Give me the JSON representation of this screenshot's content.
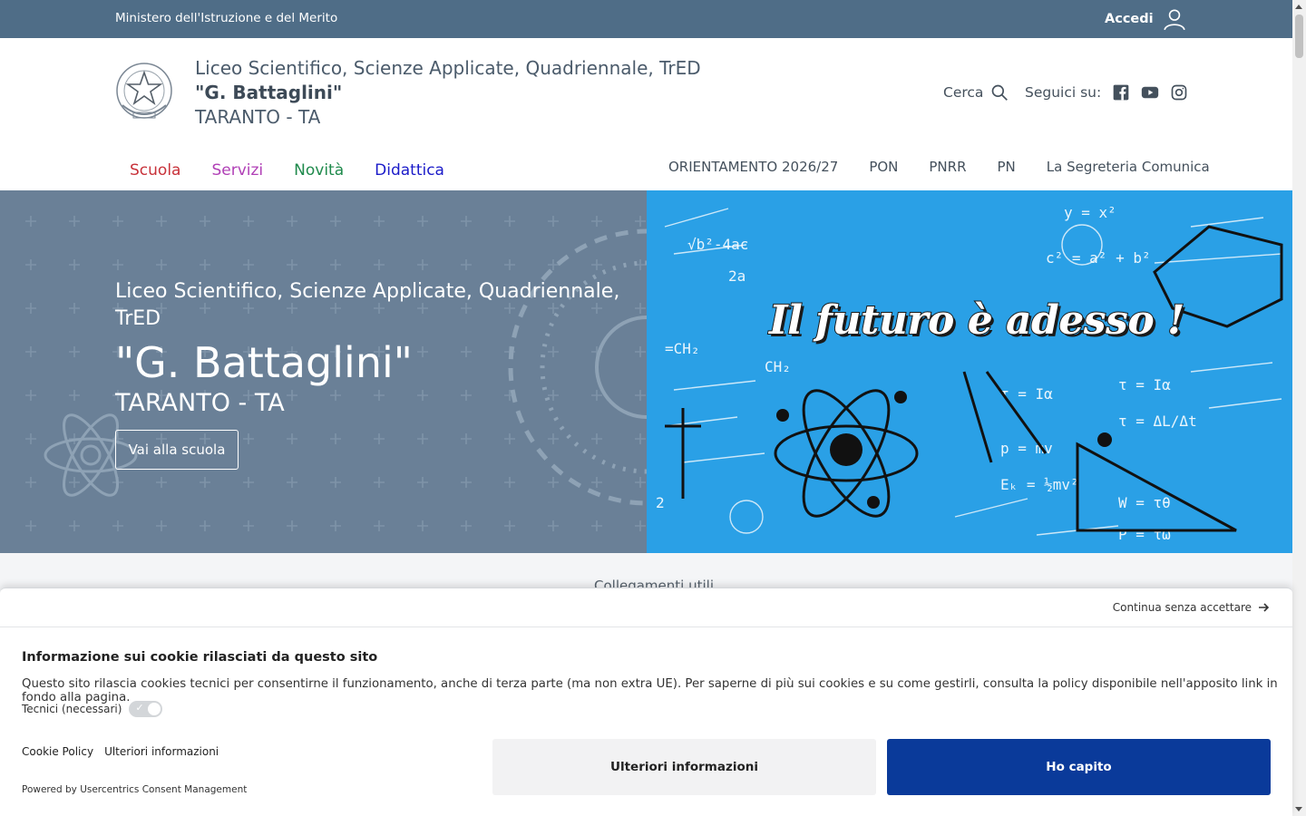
{
  "topbar": {
    "ministry": "Ministero dell'Istruzione e del Merito",
    "login": "Accedi"
  },
  "header": {
    "school_type": "Liceo Scientifico, Scienze Applicate, Quadriennale, TrED",
    "school_name": "\"G. Battaglini\"",
    "school_city": "TARANTO - TA",
    "search_label": "Cerca",
    "follow_label": "Seguici su:",
    "social_icons": [
      "facebook-icon",
      "youtube-icon",
      "instagram-icon"
    ]
  },
  "main_nav": [
    {
      "label": "Scuola",
      "color": "#c8323a"
    },
    {
      "label": "Servizi",
      "color": "#b03fb6"
    },
    {
      "label": "Novità",
      "color": "#1f8a4c"
    },
    {
      "label": "Didattica",
      "color": "#1b1bc9"
    }
  ],
  "secondary_nav": [
    "ORIENTAMENTO 2026/27",
    "PON",
    "PNRR",
    "PN",
    "La Segreteria Comunica"
  ],
  "hero": {
    "line1": "Liceo Scientifico, Scienze Applicate, Quadriennale, TrED",
    "line2": "\"G. Battaglini\"",
    "line3": "TARANTO - TA",
    "button": "Vai alla scuola",
    "image_slogan": "Il futuro è adesso !"
  },
  "useful_links": "Collegamenti utili",
  "cookie": {
    "continue": "Continua senza accettare",
    "title": "Informazione sui cookie rilasciati da questo sito",
    "description": "Questo sito rilascia cookies tecnici per consentirne il funzionamento, anche di terza parte (ma non extra UE). Per saperne di più sui cookies e su come gestirli, consulta la policy disponibile nell'apposito link in fondo alla pagina.",
    "toggle_label": "Tecnici (necessari)",
    "policy_link": "Cookie Policy",
    "more_link": "Ulteriori informazioni",
    "powered": "Powered by Usercentrics Consent Management",
    "btn_more": "Ulteriori informazioni",
    "btn_ok": "Ho capito"
  },
  "colors": {
    "topbar": "#4f6d87",
    "hero_left": "#6a8097",
    "hero_right": "#2aa0e6",
    "primary_button": "#0a3a9a"
  }
}
